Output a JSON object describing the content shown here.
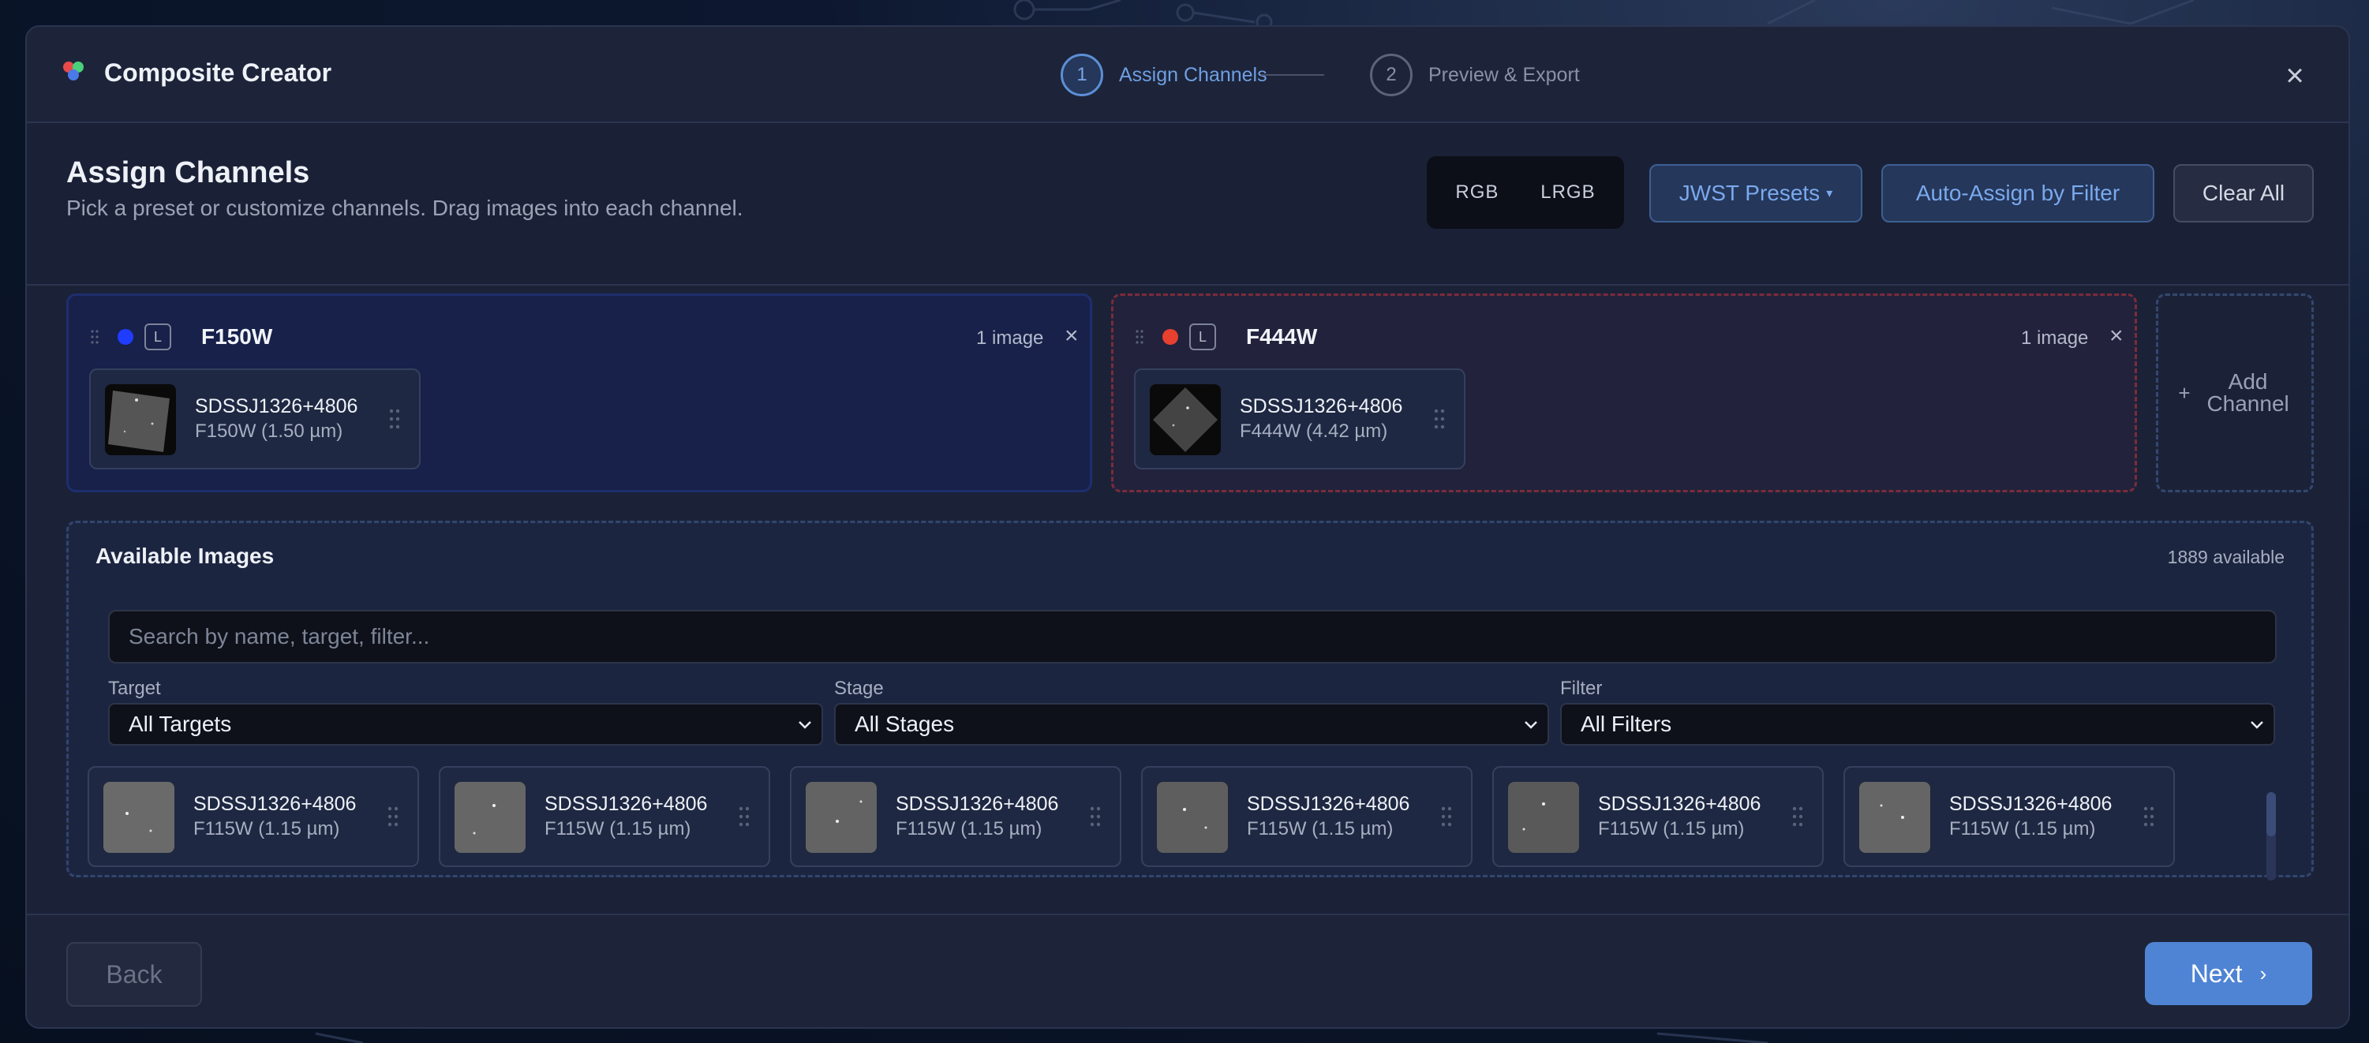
{
  "app": {
    "title": "Composite Creator",
    "close_icon": "close-icon"
  },
  "steps": [
    {
      "number": "1",
      "label": "Assign Channels",
      "active": true
    },
    {
      "number": "2",
      "label": "Preview & Export",
      "active": false
    }
  ],
  "section": {
    "title": "Assign Channels",
    "description": "Pick a preset or customize channels. Drag images into each channel."
  },
  "modes": [
    "RGB",
    "LRGB"
  ],
  "toolbar": {
    "presets_label": "JWST Presets",
    "presets_caret": "▾",
    "auto_assign_label": "Auto-Assign by Filter",
    "clear_all_label": "Clear All"
  },
  "channels": [
    {
      "color": "#1f3cff",
      "badge": "L",
      "name": "F150W",
      "count": "1 image",
      "image": {
        "name": "SDSSJ1326+4806",
        "filter": "F150W (1.50 µm)"
      }
    },
    {
      "color": "#e8402f",
      "badge": "L",
      "name": "F444W",
      "count": "1 image",
      "image": {
        "name": "SDSSJ1326+4806",
        "filter": "F444W (4.42 µm)"
      }
    }
  ],
  "add_channel": {
    "plus": "+",
    "label": "Add Channel"
  },
  "available": {
    "title": "Available Images",
    "count": "1889 available",
    "search_placeholder": "Search by name, target, filter...",
    "filters": [
      {
        "label": "Target",
        "value": "All Targets"
      },
      {
        "label": "Stage",
        "value": "All Stages"
      },
      {
        "label": "Filter",
        "value": "All Filters"
      }
    ],
    "images": [
      {
        "name": "SDSSJ1326+4806",
        "filter": "F115W (1.15 µm)"
      },
      {
        "name": "SDSSJ1326+4806",
        "filter": "F115W (1.15 µm)"
      },
      {
        "name": "SDSSJ1326+4806",
        "filter": "F115W (1.15 µm)"
      },
      {
        "name": "SDSSJ1326+4806",
        "filter": "F115W (1.15 µm)"
      },
      {
        "name": "SDSSJ1326+4806",
        "filter": "F115W (1.15 µm)"
      },
      {
        "name": "SDSSJ1326+4806",
        "filter": "F115W (1.15 µm)"
      }
    ]
  },
  "footer": {
    "back_label": "Back",
    "next_label": "Next",
    "next_arrow": "›"
  }
}
